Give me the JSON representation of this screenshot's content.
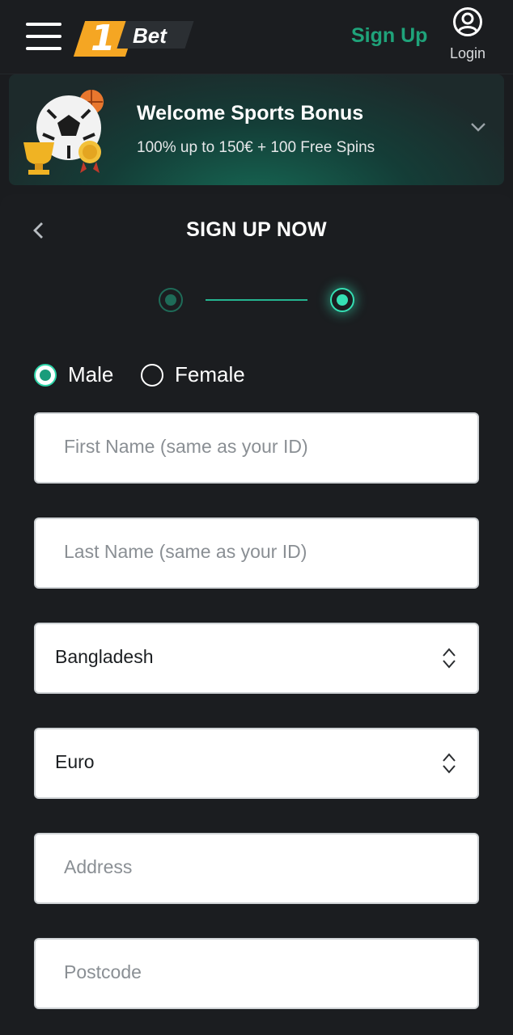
{
  "header": {
    "logo_number": "1",
    "logo_word": "Bet",
    "signup_label": "Sign Up",
    "login_label": "Login"
  },
  "bonus": {
    "title": "Welcome Sports Bonus",
    "subtitle": "100% up to 150€ + 100 Free Spins"
  },
  "form": {
    "title": "SIGN UP NOW",
    "steps": {
      "total": 2,
      "current": 2
    },
    "gender": {
      "selected": "Male",
      "options": [
        "Male",
        "Female"
      ]
    },
    "fields": {
      "first_name_placeholder": "First Name (same as your ID)",
      "last_name_placeholder": "Last Name (same as your ID)",
      "country_value": "Bangladesh",
      "currency_value": "Euro",
      "address_placeholder": "Address",
      "postcode_placeholder": "Postcode"
    }
  },
  "colors": {
    "background": "#1a1c1f",
    "accent_green": "#1fa37a",
    "step_active": "#35e0b4",
    "logo_orange": "#f5a623"
  },
  "icons": [
    "hamburger-menu-icon",
    "user-circle-icon",
    "chevron-down-icon",
    "chevron-left-icon",
    "sort-updown-icon"
  ]
}
